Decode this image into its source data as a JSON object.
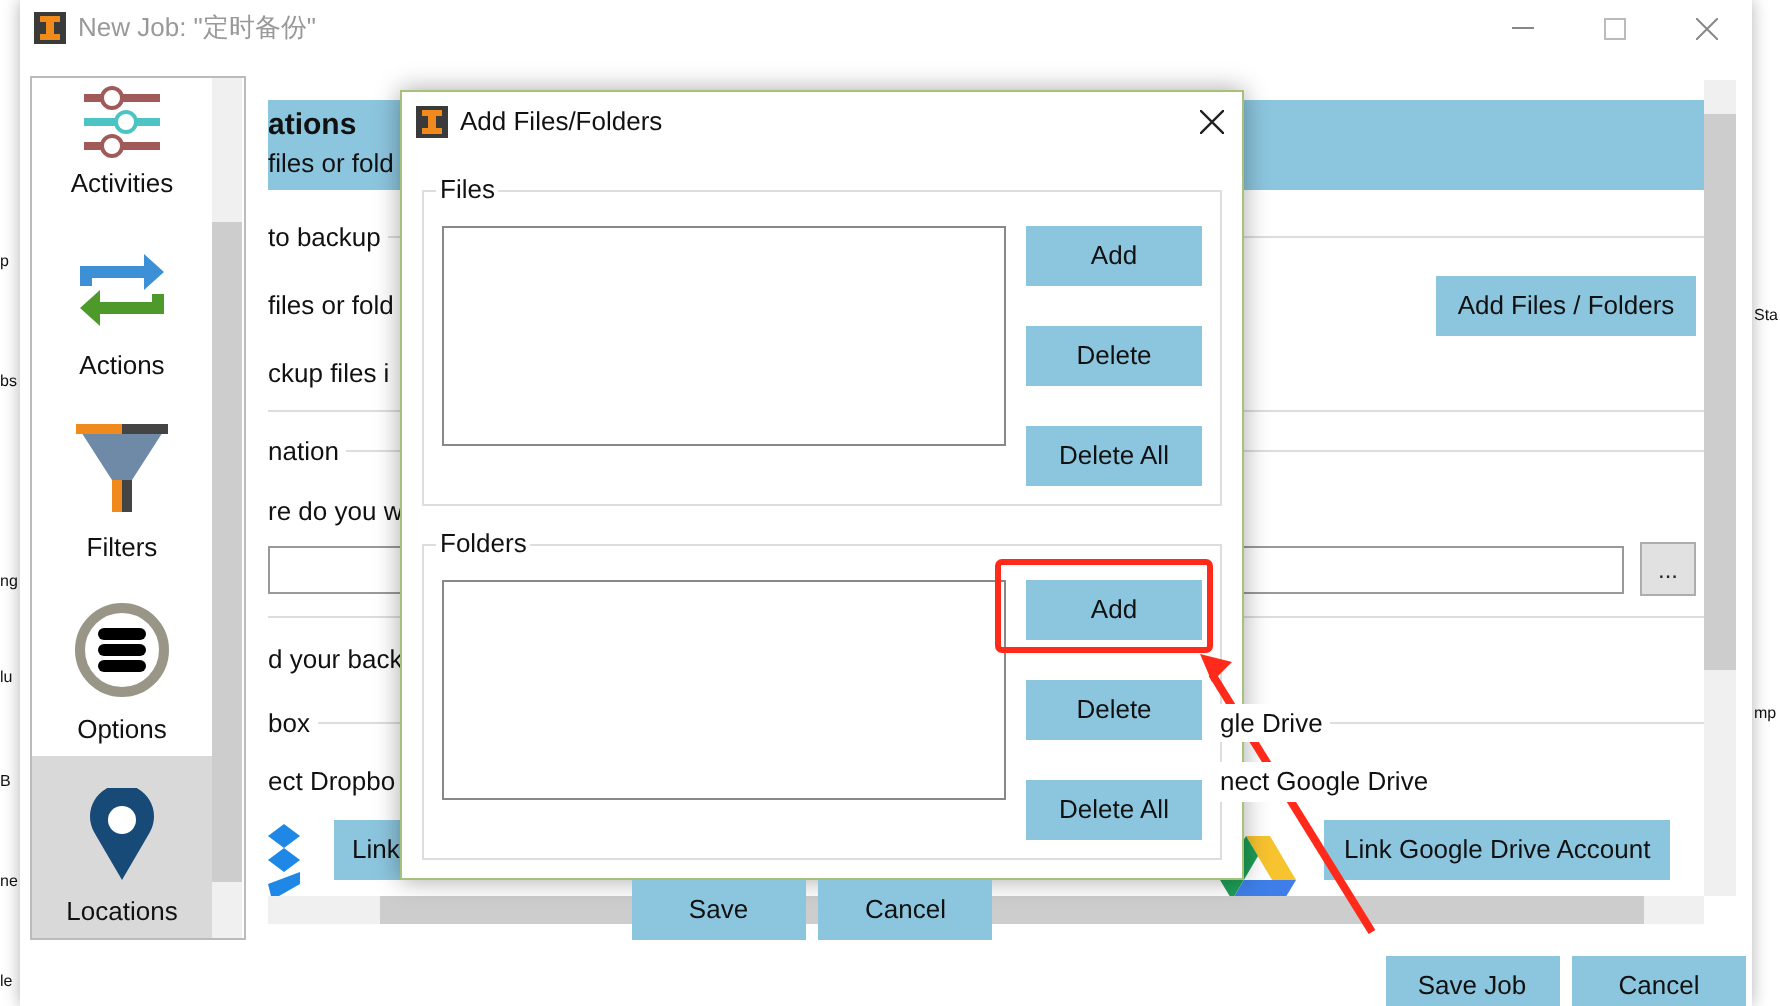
{
  "background_window": {
    "left_fragments": [
      "p",
      "bs",
      "ng",
      "lu",
      "B",
      "ne",
      "le"
    ],
    "right_fragments": [
      "Sta",
      "mp"
    ]
  },
  "window": {
    "title": "New Job: \"定时备份\""
  },
  "sidebar": {
    "items": [
      {
        "label": "Activities",
        "selected": false
      },
      {
        "label": "Actions",
        "selected": false
      },
      {
        "label": "Filters",
        "selected": false
      },
      {
        "label": "Options",
        "selected": false
      },
      {
        "label": "Locations",
        "selected": true
      }
    ]
  },
  "content": {
    "header": {
      "title": "ations",
      "subtitle": "files or fold"
    },
    "backup_section": "to backup",
    "files_text": "files or fold",
    "add_button": "Add Files / Folders",
    "backup_text": "ckup files i",
    "destination_section": "nation",
    "question": "re do you w",
    "browse_button": "...",
    "upload_text": "d your back",
    "services": [
      {
        "section": "box",
        "connect_text": "ect Dropbo",
        "link_button": "Link"
      },
      {
        "section": "gle Drive",
        "connect_text": "nect Google Drive",
        "link_button": "Link Google Drive Account"
      }
    ]
  },
  "footer_buttons": [
    "Save Job",
    "Cancel"
  ],
  "dialog": {
    "title": "Add Files/Folders",
    "groups": [
      {
        "label": "Files",
        "buttons": [
          {
            "label": "Add",
            "highlighted": false
          },
          {
            "label": "Delete",
            "highlighted": false
          },
          {
            "label": "Delete All",
            "highlighted": false
          }
        ]
      },
      {
        "label": "Folders",
        "buttons": [
          {
            "label": "Add",
            "highlighted": true
          },
          {
            "label": "Delete",
            "highlighted": false
          },
          {
            "label": "Delete All",
            "highlighted": false
          }
        ]
      }
    ],
    "buttons": [
      "Save",
      "Cancel"
    ]
  }
}
